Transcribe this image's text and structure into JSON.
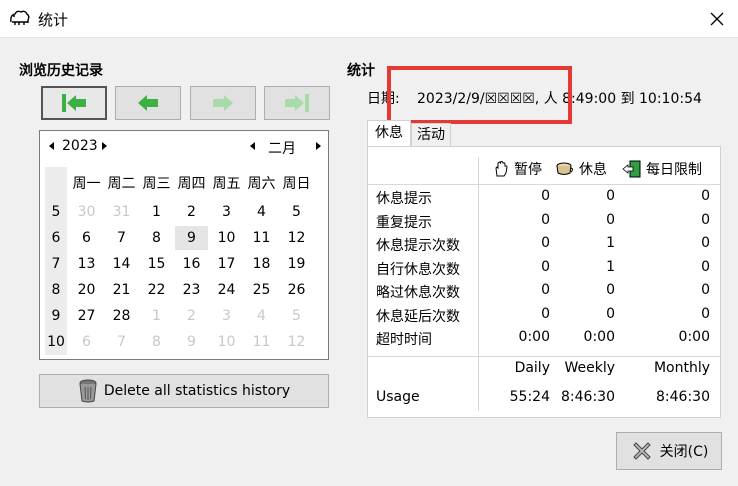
{
  "window": {
    "title": "统计"
  },
  "history": {
    "section_title": "浏览历史记录",
    "calendar": {
      "year": "2023",
      "month": "二月",
      "weekdays": [
        "周一",
        "周二",
        "周三",
        "周四",
        "周五",
        "周六",
        "周日"
      ],
      "weeks": [
        {
          "num": "5",
          "days": [
            {
              "d": "30",
              "other": true
            },
            {
              "d": "31",
              "other": true
            },
            {
              "d": "1"
            },
            {
              "d": "2"
            },
            {
              "d": "3"
            },
            {
              "d": "4"
            },
            {
              "d": "5"
            }
          ]
        },
        {
          "num": "6",
          "days": [
            {
              "d": "6"
            },
            {
              "d": "7"
            },
            {
              "d": "8"
            },
            {
              "d": "9",
              "selected": true
            },
            {
              "d": "10"
            },
            {
              "d": "11"
            },
            {
              "d": "12"
            }
          ]
        },
        {
          "num": "7",
          "days": [
            {
              "d": "13"
            },
            {
              "d": "14"
            },
            {
              "d": "15"
            },
            {
              "d": "16"
            },
            {
              "d": "17"
            },
            {
              "d": "18"
            },
            {
              "d": "19"
            }
          ]
        },
        {
          "num": "8",
          "days": [
            {
              "d": "20"
            },
            {
              "d": "21"
            },
            {
              "d": "22"
            },
            {
              "d": "23"
            },
            {
              "d": "24"
            },
            {
              "d": "25"
            },
            {
              "d": "26"
            }
          ]
        },
        {
          "num": "9",
          "days": [
            {
              "d": "27"
            },
            {
              "d": "28"
            },
            {
              "d": "1",
              "other": true
            },
            {
              "d": "2",
              "other": true
            },
            {
              "d": "3",
              "other": true
            },
            {
              "d": "4",
              "other": true
            },
            {
              "d": "5",
              "other": true
            }
          ]
        },
        {
          "num": "10",
          "days": [
            {
              "d": "6",
              "other": true
            },
            {
              "d": "7",
              "other": true
            },
            {
              "d": "8",
              "other": true
            },
            {
              "d": "9",
              "other": true
            },
            {
              "d": "10",
              "other": true
            },
            {
              "d": "11",
              "other": true
            },
            {
              "d": "12",
              "other": true
            }
          ]
        }
      ]
    },
    "delete_label": "Delete all statistics history"
  },
  "stats": {
    "section_title": "统计",
    "date_label": "日期:",
    "date_value": "2023/2/9/☒☒☒☒, 人 8:49:00 到 10:10:54",
    "tabs": [
      "休息",
      "活动"
    ],
    "headers": [
      "暂停",
      "休息",
      "每日限制"
    ],
    "rows": [
      {
        "label": "休息提示",
        "values": [
          "0",
          "0",
          "0"
        ]
      },
      {
        "label": "重复提示",
        "values": [
          "0",
          "0",
          "0"
        ]
      },
      {
        "label": "休息提示次数",
        "values": [
          "0",
          "1",
          "0"
        ]
      },
      {
        "label": "自行休息次数",
        "values": [
          "0",
          "1",
          "0"
        ]
      },
      {
        "label": "略过休息次数",
        "values": [
          "0",
          "0",
          "0"
        ]
      },
      {
        "label": "休息延后次数",
        "values": [
          "0",
          "0",
          "0"
        ]
      },
      {
        "label": "超时时间",
        "values": [
          "0:00",
          "0:00",
          "0:00"
        ]
      }
    ],
    "usage_headers": [
      "Daily",
      "Weekly",
      "Monthly"
    ],
    "usage": {
      "label": "Usage",
      "values": [
        "55:24",
        "8:46:30",
        "8:46:30"
      ]
    }
  },
  "close_label": "关闭(C)",
  "colors": {
    "highlight": "#e53935",
    "nav_green": "#3cb043",
    "nav_green_dim": "#a8dba8"
  }
}
